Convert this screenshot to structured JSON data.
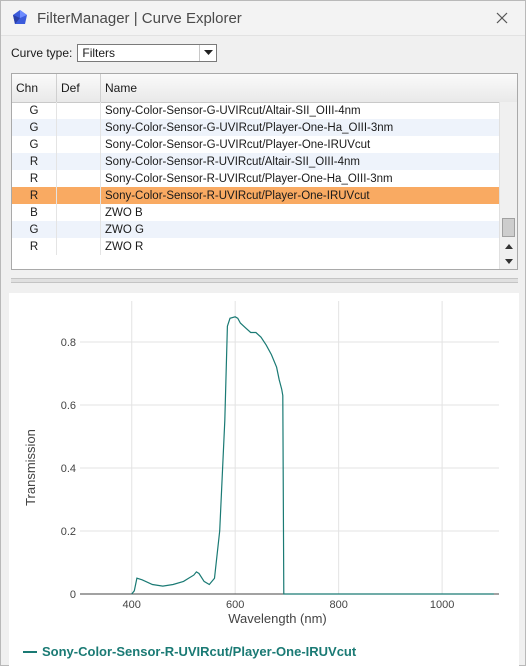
{
  "window": {
    "title": "FilterManager | Curve Explorer",
    "accent_color": "#1a7a74",
    "selected_row_color": "#f9aa62",
    "icons": {
      "app": "app-logo-icon",
      "close": "close-icon"
    }
  },
  "toolbar": {
    "curve_type_label": "Curve type:",
    "curve_type_value": "Filters"
  },
  "grid": {
    "columns": [
      "Chn",
      "Def",
      "Name"
    ],
    "rows": [
      {
        "chn": "G",
        "def": "",
        "name": "Sony-Color-Sensor-G-UVIRcut/Altair-SII_OIII-4nm",
        "selected": false
      },
      {
        "chn": "G",
        "def": "",
        "name": "Sony-Color-Sensor-G-UVIRcut/Player-One-Ha_OIII-3nm",
        "selected": false
      },
      {
        "chn": "G",
        "def": "",
        "name": "Sony-Color-Sensor-G-UVIRcut/Player-One-IRUVcut",
        "selected": false
      },
      {
        "chn": "R",
        "def": "",
        "name": "Sony-Color-Sensor-R-UVIRcut/Altair-SII_OIII-4nm",
        "selected": false
      },
      {
        "chn": "R",
        "def": "",
        "name": "Sony-Color-Sensor-R-UVIRcut/Player-One-Ha_OIII-3nm",
        "selected": false
      },
      {
        "chn": "R",
        "def": "",
        "name": "Sony-Color-Sensor-R-UVIRcut/Player-One-IRUVcut",
        "selected": true
      },
      {
        "chn": "B",
        "def": "",
        "name": "ZWO B",
        "selected": false
      },
      {
        "chn": "G",
        "def": "",
        "name": "ZWO G",
        "selected": false
      },
      {
        "chn": "R",
        "def": "",
        "name": "ZWO R",
        "selected": false
      }
    ]
  },
  "chart_data": {
    "type": "line",
    "xlabel": "Wavelength (nm)",
    "ylabel": "Transmission",
    "xlim": [
      300,
      1110
    ],
    "ylim": [
      0,
      0.93
    ],
    "xticks": [
      400,
      600,
      800,
      1000
    ],
    "yticks": [
      0,
      0.2,
      0.4,
      0.6,
      0.8
    ],
    "ytick_labels": [
      "0",
      "0.2",
      "0.4",
      "0.6",
      "0.8"
    ],
    "grid": true,
    "legend_position": "bottom-left",
    "series": [
      {
        "name": "Sony-Color-Sensor-R-UVIRcut/Player-One-IRUVcut",
        "color": "#1a7a74",
        "x": [
          400,
          405,
          410,
          420,
          440,
          460,
          480,
          500,
          510,
          520,
          525,
          530,
          540,
          550,
          560,
          570,
          580,
          585,
          590,
          600,
          605,
          610,
          620,
          630,
          640,
          650,
          660,
          670,
          680,
          685,
          690,
          692,
          694,
          700,
          800,
          900,
          1000,
          1100
        ],
        "y": [
          0,
          0.01,
          0.05,
          0.045,
          0.03,
          0.025,
          0.03,
          0.04,
          0.05,
          0.06,
          0.07,
          0.065,
          0.04,
          0.03,
          0.05,
          0.2,
          0.55,
          0.85,
          0.875,
          0.88,
          0.875,
          0.86,
          0.845,
          0.83,
          0.83,
          0.815,
          0.79,
          0.76,
          0.72,
          0.68,
          0.65,
          0.63,
          0.0,
          0.0,
          0.0,
          0.0,
          0.0,
          0.0
        ]
      }
    ]
  }
}
